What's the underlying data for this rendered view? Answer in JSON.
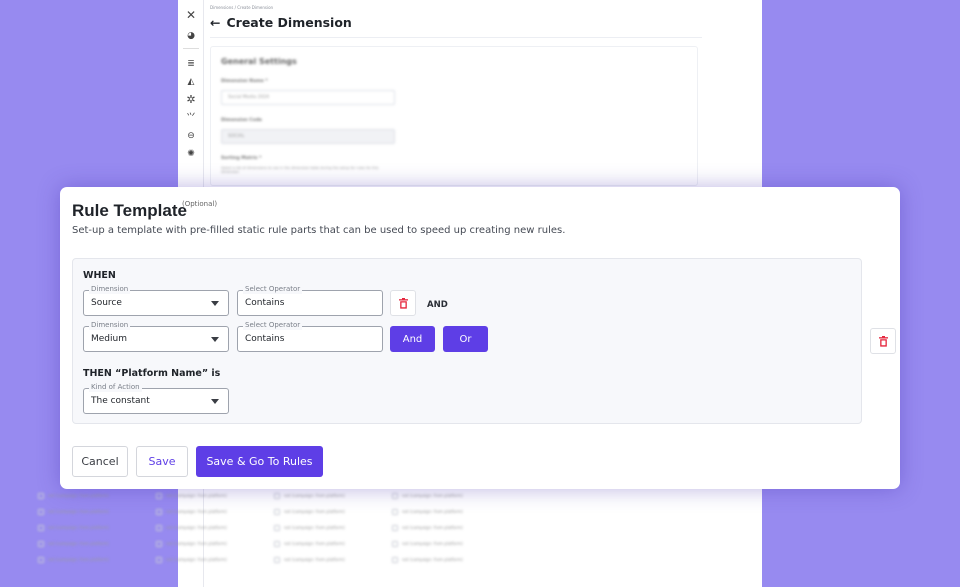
{
  "background": {
    "breadcrumb": "Dimensions / Create Dimension",
    "page_title": "Create Dimension",
    "general": {
      "section_title": "General Settings",
      "name_label": "Dimension Name *",
      "name_value": "Social Media 2024",
      "code_label": "Dimension Code",
      "code_value": "SOCIAL",
      "sort_label": "Sorting Matrix *",
      "sort_help": "Select a list of dimensions to use in the dimension table during the setup for rules for this dimension"
    },
    "checkbox_label": "not (campaign: from platform)"
  },
  "modal": {
    "title": "Rule Template",
    "optional": "(Optional)",
    "description": "Set-up a template with pre-filled static rule parts that can be used to speed up creating new rules.",
    "when_label": "WHEN",
    "rows": [
      {
        "dimension_legend": "Dimension",
        "dimension_value": "Source",
        "operator_legend": "Select Operator",
        "operator_value": "Contains"
      },
      {
        "dimension_legend": "Dimension",
        "dimension_value": "Medium",
        "operator_legend": "Select Operator",
        "operator_value": "Contains"
      }
    ],
    "and_connector": "AND",
    "and_button": "And",
    "or_button": "Or",
    "then_label": "THEN  “Platform Name” is",
    "action_legend": "Kind of Action",
    "action_value": "The constant",
    "cancel": "Cancel",
    "save": "Save",
    "save_go": "Save & Go To Rules"
  },
  "colors": {
    "accent": "#5e3ee6",
    "danger": "#e5243b",
    "backdrop": "#978af0"
  }
}
